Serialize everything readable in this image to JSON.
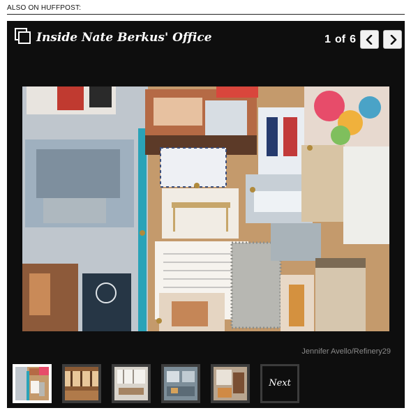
{
  "header": {
    "also_label": "ALSO ON HUFFPOST:"
  },
  "gallery": {
    "icon": "gallery-stack-icon",
    "title": "Inside Nate Berkus' Office",
    "counter": {
      "current": "1",
      "separator": "of",
      "total": "6"
    },
    "prev_icon": "chevron-left-icon",
    "next_icon": "chevron-right-icon",
    "photo_credit": "Jennifer Avello/Refinery29",
    "thumbnails": [
      {
        "name": "thumbnail-1",
        "active": true
      },
      {
        "name": "thumbnail-2",
        "active": false
      },
      {
        "name": "thumbnail-3",
        "active": false
      },
      {
        "name": "thumbnail-4",
        "active": false
      },
      {
        "name": "thumbnail-5",
        "active": false
      }
    ],
    "next_thumb_label": "Next"
  },
  "colors": {
    "gallery_background": "#0e0e0e",
    "thumb_active_border": "#ffffff",
    "thumb_border": "#3c3c3c",
    "credit_text": "#8a8a8a"
  }
}
